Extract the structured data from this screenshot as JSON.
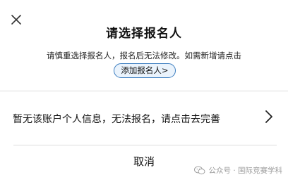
{
  "dialog": {
    "title": "请选择报名人",
    "hint": "请慎重选择报名人，报名后无法修改。如需新增请点击",
    "add_button_label": "添加报名人>",
    "info_message": "暂无该账户个人信息，无法报名，请点击去完善",
    "cancel_label": "取消"
  },
  "icons": {
    "close": "close-icon",
    "chevron": "chevron-right-icon",
    "watermark": "wechat-icon"
  },
  "watermark": {
    "text": "公众号 · 国际竞赛学科"
  },
  "colors": {
    "accent": "#3d7ec0",
    "accent_bg": "#eaf3fc",
    "divider": "#dcdcdc",
    "text": "#111111",
    "watermark": "#9a9a9a"
  }
}
